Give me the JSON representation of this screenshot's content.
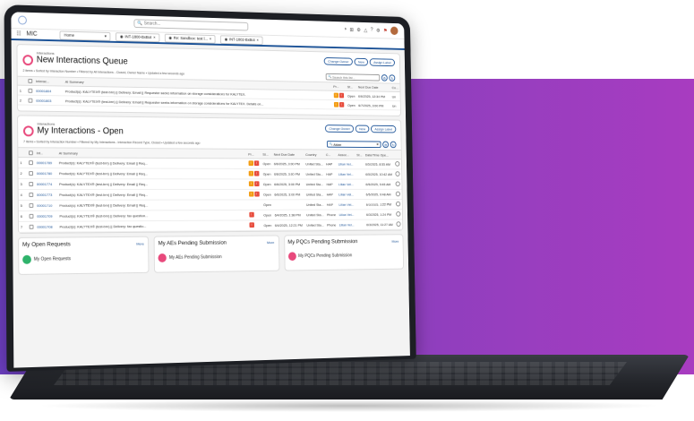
{
  "header": {
    "search_placeholder": "Search...",
    "icons": [
      "shield-icon",
      "plus-icon",
      "gear-icon",
      "bell-icon",
      "help-icon",
      "settings-icon",
      "flag-icon"
    ]
  },
  "nav": {
    "app_name": "MIC",
    "tabs": [
      {
        "label": "Home"
      },
      {
        "label": "INT-1800-BxBot"
      },
      {
        "label": "Re: Sandbox: test l..."
      },
      {
        "label": "INT-1802-BxBot"
      }
    ]
  },
  "queue": {
    "subtitle": "Interactions",
    "title": "New Interactions Queue",
    "meta": "2 items • Sorted by Interaction Number • Filtered by All Interactions - Closed, Owner Name • Updated a few seconds ago",
    "search_placeholder": "Search this list...",
    "buttons": [
      "Change Owner",
      "New",
      "Assign Label"
    ],
    "columns": [
      "Interac...",
      "AI Summary",
      "Pr...",
      "St...",
      "Next Due Date",
      "Co..."
    ],
    "rows": [
      {
        "id": "00001804",
        "summary": "Product(s): KALYTEX® (test-brn) || Delivery: Email || Requester seeks information on storage considerations for KALYTEX.",
        "status": "Open",
        "due": "6/6/2025, 12:34 PM",
        "co": "Un"
      },
      {
        "id": "00001803",
        "summary": "Product(s): KALYTEX® (test-brn) || Delivery: Email || Requester seeks information on storage considerations for KALYTEX. Details on...",
        "status": "Open",
        "due": "6/7/2025, 3:00 PM",
        "co": "Un"
      }
    ]
  },
  "open": {
    "subtitle": "Interactions",
    "title": "My Interactions - Open",
    "meta": "7 items • Sorted by Interaction Number • Filtered by My Interactions - Interaction Record Type, Closed • Updated a few seconds ago",
    "search_value": "Aidan",
    "buttons": [
      "Change Owner",
      "New",
      "Assign Label"
    ],
    "columns": [
      "Int...",
      "AI Summary",
      "Pr...",
      "St...",
      "Next Due Date",
      "Country",
      "C...",
      "Assoc...",
      "St...",
      "Date/Time Ope..."
    ],
    "rows": [
      {
        "num": "1",
        "id": "00001789",
        "summary": "Product(s): KALYTEX® (test-brn) || Delivery: Email || Req...",
        "status": "Open",
        "due": "6/6/2025, 3:00 PM",
        "country": "United Sta...",
        "ch": "HAP",
        "assoc": "Lilian Vel...",
        "opened": "6/5/2025, 8:55 AM"
      },
      {
        "num": "2",
        "id": "00001780",
        "summary": "Product(s): KALYTEX® (test-brn) || Delivery: Email || Req...",
        "status": "Open",
        "due": "6/6/2025, 3:00 PM",
        "country": "United Sta...",
        "ch": "HAP",
        "assoc": "Lilian Vel...",
        "opened": "6/5/2025, 10:42 AM"
      },
      {
        "num": "3",
        "id": "00001774",
        "summary": "Product(s): KALYTEX® (test-brn) || Delivery: Email || Req...",
        "status": "Open",
        "due": "6/6/2025, 3:00 PM",
        "country": "United Sta...",
        "ch": "HAP",
        "assoc": "Lilian Vel...",
        "opened": "6/5/2025, 9:45 AM"
      },
      {
        "num": "4",
        "id": "00001773",
        "summary": "Product(s): KALYTEX® (test-brn) || Delivery: Email || Req...",
        "status": "Open",
        "due": "6/6/2025, 3:00 PM",
        "country": "United Sta...",
        "ch": "HAP",
        "assoc": "Lilian Vel...",
        "opened": "6/5/2025, 9:48 AM"
      },
      {
        "num": "5",
        "id": "00001710",
        "summary": "Product(s): KALYTEX® (test-brn) || Delivery: Email || Req...",
        "status": "Open",
        "due": "",
        "country": "United Sta...",
        "ch": "HAP",
        "assoc": "Lilian Vel...",
        "opened": "6/3/2025, 1:22 PM"
      },
      {
        "num": "6",
        "id": "00001709",
        "summary": "Product(s): KALYTEX® (test-brn) || Delivery: fax question...",
        "status": "Open",
        "due": "6/4/2025, 1:38 PM",
        "country": "United Sta...",
        "ch": "Phone",
        "assoc": "Lilian Vel...",
        "opened": "6/3/2025, 1:24 PM"
      },
      {
        "num": "7",
        "id": "00001708",
        "summary": "Product(s): KALYTEX® (test-brn) || Delivery: fax questio...",
        "status": "Open",
        "due": "6/4/2025, 12:21 PM",
        "country": "United Sta...",
        "ch": "Phone",
        "assoc": "Lilian Vel...",
        "opened": "6/3/2025, 11:27 AM"
      }
    ]
  },
  "bottom": [
    {
      "title": "My Open Requests",
      "link": "More",
      "sub": "My Open Requests",
      "color": "#2fb36b"
    },
    {
      "title": "My AEs Pending Submission",
      "link": "More",
      "sub": "My AEs Pending Submission",
      "color": "#e8497c"
    },
    {
      "title": "My PQCs Pending Submission",
      "link": "More",
      "sub": "My PQCs Pending Submission",
      "color": "#e8497c"
    }
  ]
}
